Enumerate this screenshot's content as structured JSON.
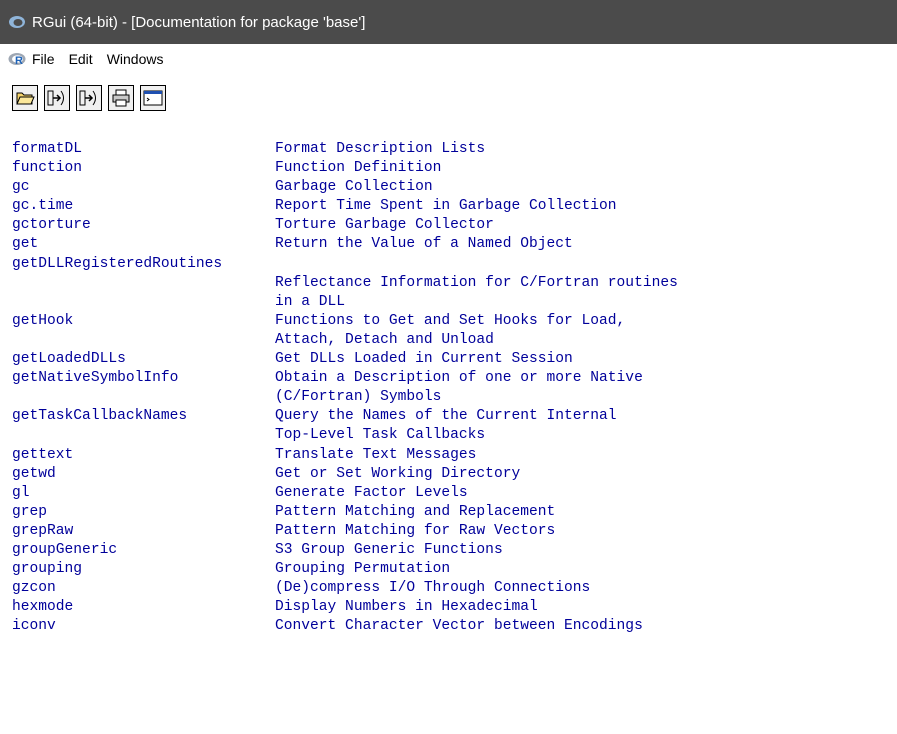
{
  "window": {
    "title": "RGui (64-bit) - [Documentation for package 'base']"
  },
  "menubar": {
    "items": [
      "File",
      "Edit",
      "Windows"
    ]
  },
  "toolbar": {
    "buttons": [
      "open-folder-icon",
      "load-workspace-icon",
      "save-workspace-icon",
      "print-icon",
      "console-icon"
    ]
  },
  "rows": [
    {
      "fn": "formatDL",
      "desc": "Format Description Lists"
    },
    {
      "fn": "function",
      "desc": "Function Definition"
    },
    {
      "fn": "gc",
      "desc": "Garbage Collection"
    },
    {
      "fn": "gc.time",
      "desc": "Report Time Spent in Garbage Collection"
    },
    {
      "fn": "gctorture",
      "desc": "Torture Garbage Collector"
    },
    {
      "fn": "get",
      "desc": "Return the Value of a Named Object"
    },
    {
      "fn": "getDLLRegisteredRoutines",
      "desc": ""
    },
    {
      "fn": "",
      "desc": "Reflectance Information for C/Fortran routines"
    },
    {
      "fn": "",
      "desc": "in a DLL"
    },
    {
      "fn": "getHook",
      "desc": "Functions to Get and Set Hooks for Load,"
    },
    {
      "fn": "",
      "desc": "Attach, Detach and Unload"
    },
    {
      "fn": "getLoadedDLLs",
      "desc": "Get DLLs Loaded in Current Session"
    },
    {
      "fn": "getNativeSymbolInfo",
      "desc": "Obtain a Description of one or more Native"
    },
    {
      "fn": "",
      "desc": "(C/Fortran) Symbols"
    },
    {
      "fn": "getTaskCallbackNames",
      "desc": "Query the Names of the Current Internal"
    },
    {
      "fn": "",
      "desc": "Top-Level Task Callbacks"
    },
    {
      "fn": "gettext",
      "desc": "Translate Text Messages"
    },
    {
      "fn": "getwd",
      "desc": "Get or Set Working Directory"
    },
    {
      "fn": "gl",
      "desc": "Generate Factor Levels"
    },
    {
      "fn": "grep",
      "desc": "Pattern Matching and Replacement"
    },
    {
      "fn": "grepRaw",
      "desc": "Pattern Matching for Raw Vectors"
    },
    {
      "fn": "groupGeneric",
      "desc": "S3 Group Generic Functions"
    },
    {
      "fn": "grouping",
      "desc": "Grouping Permutation"
    },
    {
      "fn": "gzcon",
      "desc": "(De)compress I/O Through Connections"
    },
    {
      "fn": "hexmode",
      "desc": "Display Numbers in Hexadecimal"
    },
    {
      "fn": "iconv",
      "desc": "Convert Character Vector between Encodings"
    }
  ]
}
